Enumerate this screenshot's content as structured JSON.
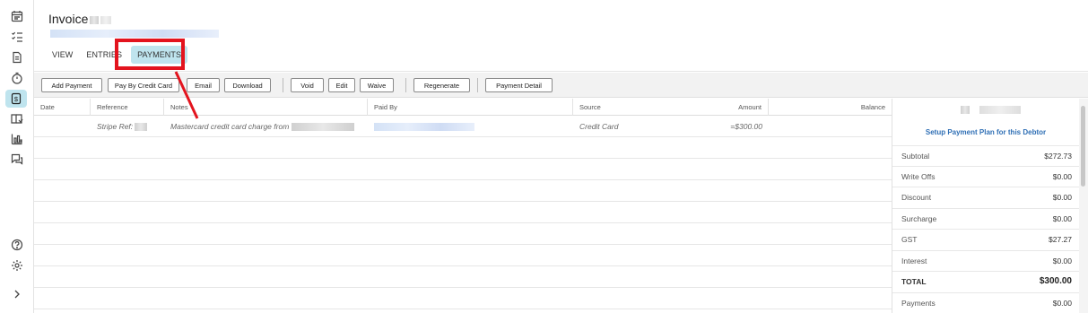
{
  "invoice": {
    "title": "Invoice"
  },
  "tabs": [
    {
      "label": "VIEW"
    },
    {
      "label": "ENTRIES"
    },
    {
      "label": "PAYMENTS"
    }
  ],
  "toolbar": {
    "add_payment": "Add Payment",
    "pay_by_credit_card": "Pay By Credit Card",
    "email": "Email",
    "download": "Download",
    "void": "Void",
    "edit": "Edit",
    "waive": "Waive",
    "regenerate": "Regenerate",
    "payment_detail": "Payment Detail"
  },
  "table": {
    "columns": [
      "Date",
      "Reference",
      "Notes",
      "Paid By",
      "Source",
      "Amount",
      "Balance"
    ],
    "rows": [
      {
        "date": "",
        "reference": "Stripe Ref:",
        "notes": "Mastercard credit card charge from",
        "paid_by": "",
        "source": "Credit Card",
        "amount": "=$300.00",
        "balance": ""
      }
    ]
  },
  "summary": {
    "setup_link": "Setup Payment Plan for this Debtor",
    "items": [
      {
        "label": "Subtotal",
        "value": "$272.73"
      },
      {
        "label": "Write Offs",
        "value": "$0.00"
      },
      {
        "label": "Discount",
        "value": "$0.00"
      },
      {
        "label": "Surcharge",
        "value": "$0.00"
      },
      {
        "label": "GST",
        "value": "$27.27"
      },
      {
        "label": "Interest",
        "value": "$0.00"
      },
      {
        "label": "TOTAL",
        "value": "$300.00"
      },
      {
        "label": "Payments",
        "value": "$0.00"
      }
    ]
  },
  "rail_icons": [
    "calendar-icon",
    "task-list-icon",
    "document-icon",
    "stopwatch-icon",
    "billing-icon",
    "book-icon",
    "bar-chart-icon",
    "chat-icon",
    "help-icon",
    "settings-icon",
    "chevron-right-icon"
  ],
  "colors": {
    "accent": "#bfe4ee",
    "highlight": "#e3141e",
    "link": "#2f6fb5"
  }
}
